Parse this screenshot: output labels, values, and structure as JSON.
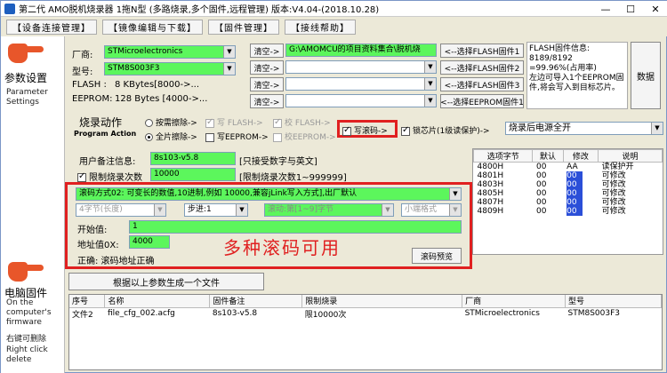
{
  "window": {
    "title": "第二代 AMO脱机烧录器 1拖N型 (多路烧录,多个固件,远程管理)  版本:V4.04-(2018.10.28)"
  },
  "menus": [
    "【设备连接管理】",
    "【镜像编辑与下载】",
    "【固件管理】",
    "【接线帮助】"
  ],
  "sidebar": {
    "params_cn": "参数设置",
    "params_en": "Parameter Settings",
    "pc_fw_cn": "电脑固件",
    "pc_fw_en": "On the computer's firmware",
    "del_cn": "右键可删除",
    "del_en": "Right click delete"
  },
  "device": {
    "vendor_label": "厂商:",
    "vendor": "STMicroelectronics",
    "model_label": "型号:",
    "model": "STM8S003F3",
    "flash_label": "FLASH :",
    "flash": "8 KBytes[8000->...",
    "eeprom_label": "EEPROM:",
    "eeprom": "128 Bytes [4000->..."
  },
  "clear_label": "清空->",
  "firmware_path": "G:\\AMOMCU的项目资料集合\\脱机烧",
  "select_fw": [
    "<--选择FLASH固件1",
    "<--选择FLASH固件2",
    "<--选择FLASH固件3",
    "<--选择EEPROM固件1"
  ],
  "flash_info": {
    "line1": "FLASH固件信息:",
    "line2": "8189/8192",
    "line3": "=99.96%(占用率)",
    "line4": "左边可导入1个EEPROM固件,将会写入到目标芯片。"
  },
  "data_button": "数据",
  "program_action": {
    "title_cn": "烧录动作",
    "title_en": "Program Action",
    "erase_sector": "按需擦除->",
    "write_flash": "写 FLASH->",
    "verify_flash": "校 FLASH->",
    "erase_all": "全片擦除->",
    "write_eeprom": "写EEPROM->",
    "verify_eeprom": "校EEPROM->",
    "write_roll": "写滚码->",
    "lock_chip": "锁芯片(1级读保护)->",
    "after_burn": "烧录后电源全开"
  },
  "note": {
    "label": "用户备注信息:",
    "value": "8s103-v5.8",
    "hint": "[只接受数字与英文]"
  },
  "limit": {
    "label": "限制烧录次数",
    "value": "10000",
    "hint": "[限制烧录次数1~999999]"
  },
  "roll": {
    "mode": "滚码方式02: 可变长的数值,10进制,例如 10000,兼容jLink写入方式],出厂默认",
    "bytes": "4字节(长度)",
    "step": "步进:1",
    "roll_fmt": "滚动:第[1~9]字节",
    "endian": "小端格式",
    "start_label": "开始值:",
    "start_value": "1",
    "addr_label": "地址值0X:",
    "addr_value": "4000",
    "status": "正确: 滚码地址正确",
    "preview": "滚码预览",
    "big_text": "多种滚码可用"
  },
  "options": {
    "headers": [
      "选项字节",
      "默认",
      "修改",
      "说明"
    ],
    "rows": [
      [
        "4800H",
        "00",
        "AA",
        "读保护开"
      ],
      [
        "4801H",
        "00",
        "00",
        "可修改"
      ],
      [
        "4803H",
        "00",
        "00",
        "可修改"
      ],
      [
        "4805H",
        "00",
        "00",
        "可修改"
      ],
      [
        "4807H",
        "00",
        "00",
        "可修改"
      ],
      [
        "4809H",
        "00",
        "00",
        "可修改"
      ]
    ]
  },
  "gen_button": "根据以上参数生成一个文件",
  "files": {
    "headers": [
      "序号",
      "名称",
      "固件备注",
      "限制烧录",
      "厂商",
      "型号"
    ],
    "rows": [
      [
        "文件2",
        "file_cfg_002.acfg",
        "8s103-v5.8",
        "限10000次",
        "STMicroelectronics",
        "STM8S003F3"
      ]
    ]
  },
  "colors": {
    "green": "#5cf65c",
    "red": "#e02020",
    "hand": "#e8562a"
  }
}
